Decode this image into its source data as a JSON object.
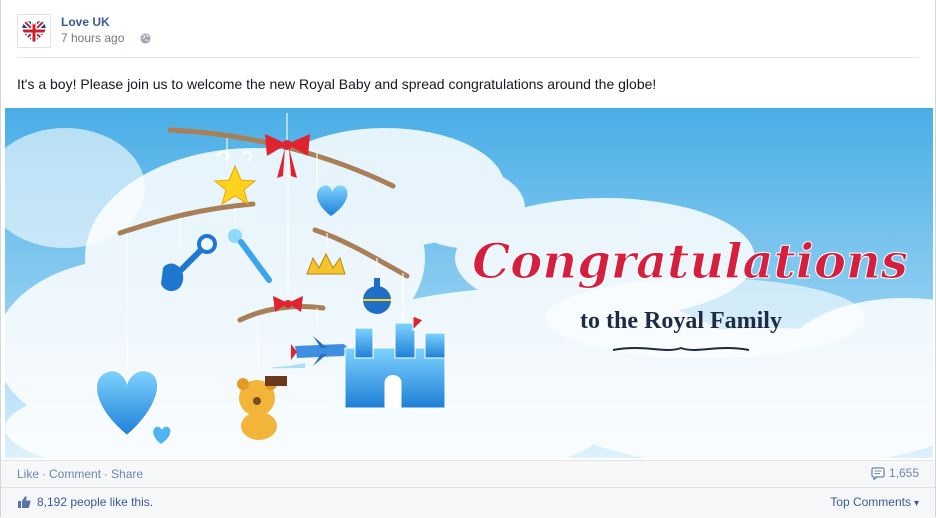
{
  "post": {
    "author": "Love UK",
    "timestamp": "7 hours ago",
    "message": "It's a boy! Please join us to welcome the new Royal Baby and spread congratulations around the globe!"
  },
  "photo": {
    "headline": "Congratulations",
    "subline": "to the Royal Family"
  },
  "actions": {
    "like": "Like",
    "comment": "Comment",
    "share": "Share",
    "separator": "·",
    "comment_count": "1,655"
  },
  "likes": {
    "count": "8,192",
    "suffix": "people like this.",
    "top_comments": "Top Comments",
    "top_comments_caret": "▾"
  },
  "icons": {
    "globe": "globe-icon",
    "comment_count": "comment-bubble-icon",
    "like": "thumbs-up-icon"
  },
  "colors": {
    "link": "#3b5998",
    "action_link": "#6d84b4",
    "headline": "#d41f3f",
    "subline": "#1f2a44",
    "sky_top": "#5bb4e8",
    "sky_bottom": "#c8e6f8"
  }
}
